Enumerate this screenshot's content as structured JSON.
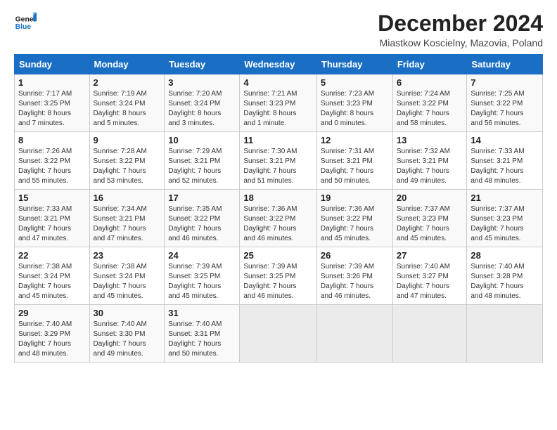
{
  "logo": {
    "line1": "General",
    "line2": "Blue"
  },
  "title": "December 2024",
  "subtitle": "Miastkow Koscielny, Mazovia, Poland",
  "days_of_week": [
    "Sunday",
    "Monday",
    "Tuesday",
    "Wednesday",
    "Thursday",
    "Friday",
    "Saturday"
  ],
  "weeks": [
    [
      {
        "day": 1,
        "info": "Sunrise: 7:17 AM\nSunset: 3:25 PM\nDaylight: 8 hours\nand 7 minutes."
      },
      {
        "day": 2,
        "info": "Sunrise: 7:19 AM\nSunset: 3:24 PM\nDaylight: 8 hours\nand 5 minutes."
      },
      {
        "day": 3,
        "info": "Sunrise: 7:20 AM\nSunset: 3:24 PM\nDaylight: 8 hours\nand 3 minutes."
      },
      {
        "day": 4,
        "info": "Sunrise: 7:21 AM\nSunset: 3:23 PM\nDaylight: 8 hours\nand 1 minute."
      },
      {
        "day": 5,
        "info": "Sunrise: 7:23 AM\nSunset: 3:23 PM\nDaylight: 8 hours\nand 0 minutes."
      },
      {
        "day": 6,
        "info": "Sunrise: 7:24 AM\nSunset: 3:22 PM\nDaylight: 7 hours\nand 58 minutes."
      },
      {
        "day": 7,
        "info": "Sunrise: 7:25 AM\nSunset: 3:22 PM\nDaylight: 7 hours\nand 56 minutes."
      }
    ],
    [
      {
        "day": 8,
        "info": "Sunrise: 7:26 AM\nSunset: 3:22 PM\nDaylight: 7 hours\nand 55 minutes."
      },
      {
        "day": 9,
        "info": "Sunrise: 7:28 AM\nSunset: 3:22 PM\nDaylight: 7 hours\nand 53 minutes."
      },
      {
        "day": 10,
        "info": "Sunrise: 7:29 AM\nSunset: 3:21 PM\nDaylight: 7 hours\nand 52 minutes."
      },
      {
        "day": 11,
        "info": "Sunrise: 7:30 AM\nSunset: 3:21 PM\nDaylight: 7 hours\nand 51 minutes."
      },
      {
        "day": 12,
        "info": "Sunrise: 7:31 AM\nSunset: 3:21 PM\nDaylight: 7 hours\nand 50 minutes."
      },
      {
        "day": 13,
        "info": "Sunrise: 7:32 AM\nSunset: 3:21 PM\nDaylight: 7 hours\nand 49 minutes."
      },
      {
        "day": 14,
        "info": "Sunrise: 7:33 AM\nSunset: 3:21 PM\nDaylight: 7 hours\nand 48 minutes."
      }
    ],
    [
      {
        "day": 15,
        "info": "Sunrise: 7:33 AM\nSunset: 3:21 PM\nDaylight: 7 hours\nand 47 minutes."
      },
      {
        "day": 16,
        "info": "Sunrise: 7:34 AM\nSunset: 3:21 PM\nDaylight: 7 hours\nand 47 minutes."
      },
      {
        "day": 17,
        "info": "Sunrise: 7:35 AM\nSunset: 3:22 PM\nDaylight: 7 hours\nand 46 minutes."
      },
      {
        "day": 18,
        "info": "Sunrise: 7:36 AM\nSunset: 3:22 PM\nDaylight: 7 hours\nand 46 minutes."
      },
      {
        "day": 19,
        "info": "Sunrise: 7:36 AM\nSunset: 3:22 PM\nDaylight: 7 hours\nand 45 minutes."
      },
      {
        "day": 20,
        "info": "Sunrise: 7:37 AM\nSunset: 3:23 PM\nDaylight: 7 hours\nand 45 minutes."
      },
      {
        "day": 21,
        "info": "Sunrise: 7:37 AM\nSunset: 3:23 PM\nDaylight: 7 hours\nand 45 minutes."
      }
    ],
    [
      {
        "day": 22,
        "info": "Sunrise: 7:38 AM\nSunset: 3:24 PM\nDaylight: 7 hours\nand 45 minutes."
      },
      {
        "day": 23,
        "info": "Sunrise: 7:38 AM\nSunset: 3:24 PM\nDaylight: 7 hours\nand 45 minutes."
      },
      {
        "day": 24,
        "info": "Sunrise: 7:39 AM\nSunset: 3:25 PM\nDaylight: 7 hours\nand 45 minutes."
      },
      {
        "day": 25,
        "info": "Sunrise: 7:39 AM\nSunset: 3:25 PM\nDaylight: 7 hours\nand 46 minutes."
      },
      {
        "day": 26,
        "info": "Sunrise: 7:39 AM\nSunset: 3:26 PM\nDaylight: 7 hours\nand 46 minutes."
      },
      {
        "day": 27,
        "info": "Sunrise: 7:40 AM\nSunset: 3:27 PM\nDaylight: 7 hours\nand 47 minutes."
      },
      {
        "day": 28,
        "info": "Sunrise: 7:40 AM\nSunset: 3:28 PM\nDaylight: 7 hours\nand 48 minutes."
      }
    ],
    [
      {
        "day": 29,
        "info": "Sunrise: 7:40 AM\nSunset: 3:29 PM\nDaylight: 7 hours\nand 48 minutes."
      },
      {
        "day": 30,
        "info": "Sunrise: 7:40 AM\nSunset: 3:30 PM\nDaylight: 7 hours\nand 49 minutes."
      },
      {
        "day": 31,
        "info": "Sunrise: 7:40 AM\nSunset: 3:31 PM\nDaylight: 7 hours\nand 50 minutes."
      },
      null,
      null,
      null,
      null
    ]
  ]
}
